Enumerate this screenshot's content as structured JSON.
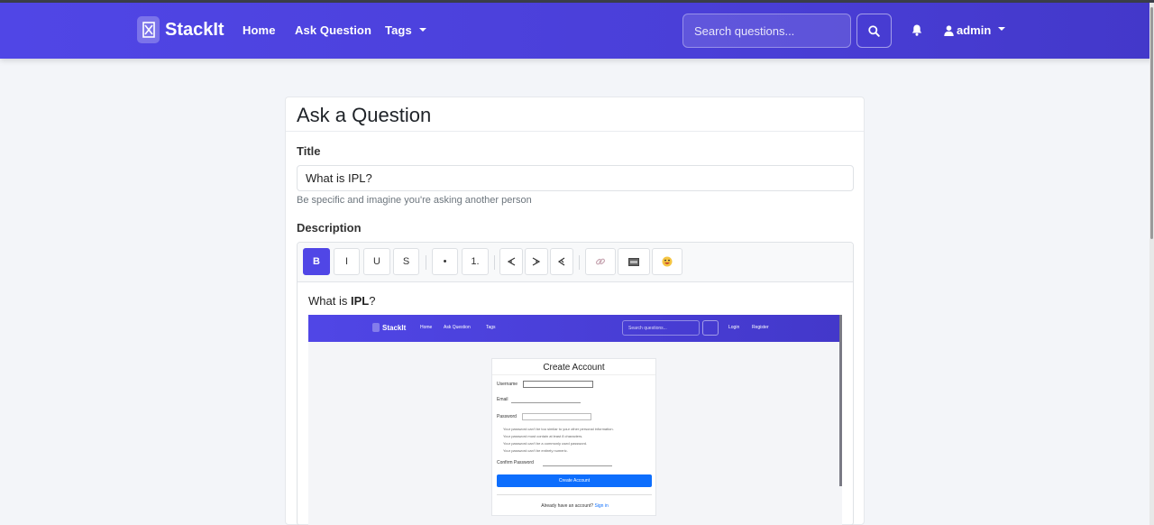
{
  "navbar": {
    "brand": "StackIt",
    "links": [
      "Home",
      "Ask Question",
      "Tags"
    ],
    "search_placeholder": "Search questions...",
    "user": "admin"
  },
  "page": {
    "heading": "Ask a Question",
    "title_label": "Title",
    "title_value": "What is IPL?",
    "title_help": "Be specific and imagine you're asking another person",
    "description_label": "Description"
  },
  "toolbar": {
    "buttons": [
      "B",
      "I",
      "U",
      "S",
      "•",
      "1."
    ],
    "icons": [
      "align-left-icon",
      "align-center-icon",
      "align-right-icon",
      "link-icon",
      "image-icon",
      "emoji-icon"
    ]
  },
  "editor": {
    "text_before": "What is ",
    "text_bold": "IPL",
    "text_after": "?"
  },
  "embedded_screenshot": {
    "brand": "StackIt",
    "links": [
      "Home",
      "Ask Question",
      "Tags"
    ],
    "search_placeholder": "Search questions...",
    "login": "Login",
    "register": "Register",
    "card_title": "Create Account",
    "username_label": "Username",
    "email_label": "Email",
    "password_label": "Password",
    "password_rules": [
      "Your password can't be too similar to your other personal information.",
      "Your password must contain at least 8 characters.",
      "Your password can't be a commonly used password.",
      "Your password can't be entirely numeric."
    ],
    "confirm_label": "Confirm Password",
    "create_button": "Create Account",
    "footer_text": "Already have an account?",
    "footer_link": "Sign in"
  },
  "colors": {
    "primary": "#5046e6",
    "navbar_end": "#4338ca",
    "link_blue": "#0d6efd"
  }
}
